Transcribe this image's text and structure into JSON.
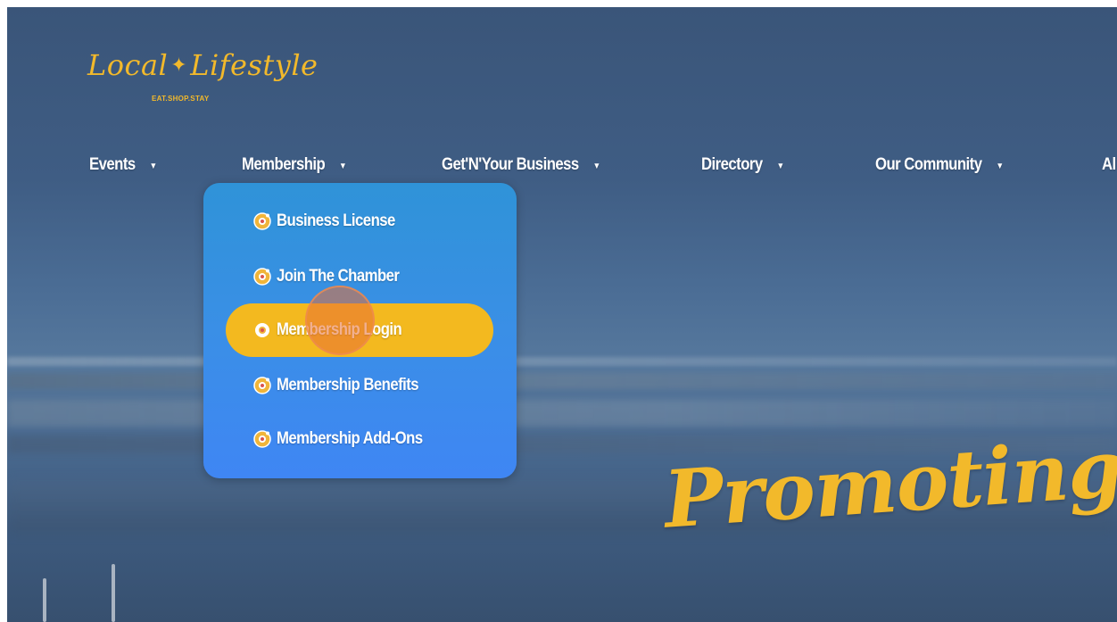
{
  "logo": {
    "script_left": "Local",
    "script_right": "Lifestyle",
    "tagline": "EAT.SHOP.STAY"
  },
  "nav": {
    "items": [
      {
        "label": "Events"
      },
      {
        "label": "Membership"
      },
      {
        "label": "Get'N'Your Business"
      },
      {
        "label": "Directory"
      },
      {
        "label": "Our Community"
      },
      {
        "label": "Al"
      }
    ],
    "caret": "▼"
  },
  "dropdown": {
    "items": [
      {
        "label": "Business License"
      },
      {
        "label": "Join The Chamber"
      },
      {
        "label": "Membership Login",
        "highlighted": true
      },
      {
        "label": "Membership Benefits"
      },
      {
        "label": "Membership Add-Ons"
      }
    ]
  },
  "hero": {
    "text": "Promoting Busin"
  },
  "colors": {
    "accent_gold": "#f3b91f",
    "dropdown_blue": "#3a8fe6",
    "text_white": "#ffffff"
  },
  "icons": {
    "menu_item_icon": "compass-icon",
    "dropdown_caret": "caret-down-icon"
  }
}
